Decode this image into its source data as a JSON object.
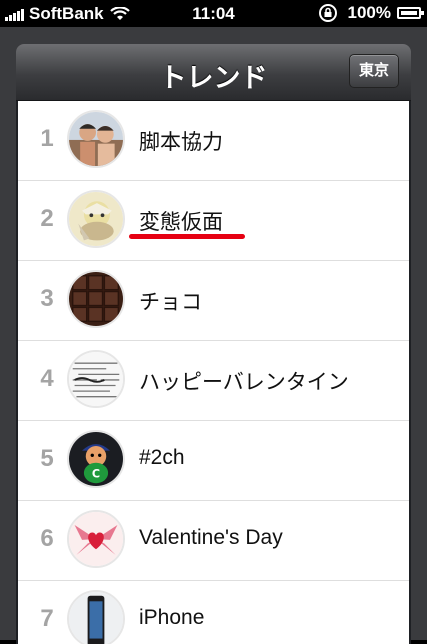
{
  "status_bar": {
    "carrier": "SoftBank",
    "time": "11:04",
    "battery": "100%"
  },
  "nav": {
    "title": "トレンド",
    "region_button": "東京"
  },
  "trends": [
    {
      "rank": "1",
      "label": "脚本協力",
      "icon": "people-photo-icon"
    },
    {
      "rank": "2",
      "label": "変態仮面",
      "icon": "masked-figure-icon",
      "highlighted": true
    },
    {
      "rank": "3",
      "label": "チョコ",
      "icon": "chocolate-bar-icon"
    },
    {
      "rank": "4",
      "label": "ハッピーバレンタイン",
      "icon": "text-collage-icon"
    },
    {
      "rank": "5",
      "label": "#2ch",
      "icon": "mascot-character-icon"
    },
    {
      "rank": "6",
      "label": "Valentine's Day",
      "icon": "heart-ornament-icon"
    },
    {
      "rank": "7",
      "label": "iPhone",
      "icon": "iphone-icon"
    }
  ],
  "colors": {
    "highlight_underline": "#e60012",
    "rank_text": "#a4a4a4"
  }
}
